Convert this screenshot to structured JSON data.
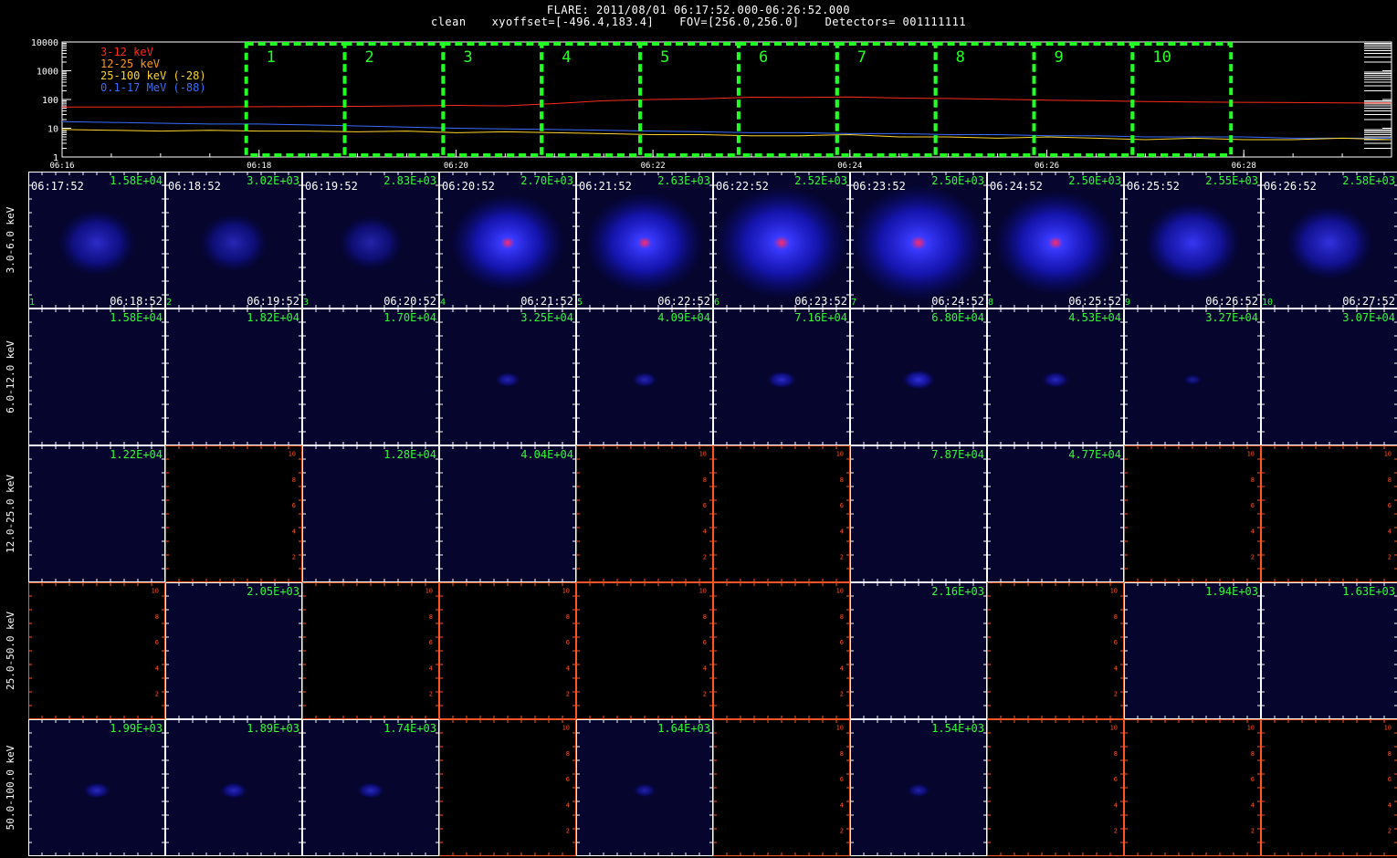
{
  "header": {
    "line1": "FLARE: 2011/08/01 06:17:52.000-06:26:52.000",
    "method": "clean",
    "xyoffset": "xyoffset=[-496.4,183.4]",
    "fov": "FOV=[256.0,256.0]",
    "detectors": "Detectors= 001111111"
  },
  "chart_data": [
    {
      "type": "line",
      "name": "lightcurve",
      "yscale": "log",
      "ylim": [
        1,
        10000
      ],
      "ytick_labels": [
        "1",
        "10",
        "100",
        "1000",
        "10000"
      ],
      "xtick_labels": [
        "06:16",
        "06:18",
        "06:20",
        "06:22",
        "06:24",
        "06:26",
        "06:28"
      ],
      "xlim_min": [
        16,
        29.5
      ],
      "legend": [
        {
          "label": "3-12 keV",
          "color": "#ff2a1a"
        },
        {
          "label": "12-25 keV",
          "color": "#ff9a1a"
        },
        {
          "label": "25-100 keV (-28)",
          "color": "#ffd52a"
        },
        {
          "label": "0.1-17 MeV (-88)",
          "color": "#3a6cff"
        }
      ],
      "series": [
        {
          "name": "3-12 keV",
          "color": "#ff2a1a",
          "x": [
            16,
            17,
            18,
            19,
            20,
            20.5,
            21,
            21.5,
            22,
            22.5,
            23,
            23.5,
            24,
            24.5,
            25,
            25.5,
            26,
            26.5,
            27,
            27.5,
            28,
            28.5,
            29,
            29.5
          ],
          "y": [
            55,
            55,
            56,
            58,
            62,
            60,
            72,
            90,
            100,
            105,
            120,
            118,
            122,
            112,
            108,
            102,
            95,
            90,
            85,
            82,
            80,
            78,
            76,
            75
          ]
        },
        {
          "name": "0.1-17 MeV (-88)",
          "color": "#3a6cff",
          "x": [
            16,
            16.5,
            17,
            17.5,
            18,
            18.5,
            19,
            19.5,
            20,
            20.5,
            21,
            21.5,
            22,
            22.5,
            23,
            23.5,
            24,
            24.5,
            25,
            25.5,
            26,
            26.5,
            27,
            27.5,
            28,
            28.5,
            29,
            29.5
          ],
          "y": [
            17,
            16,
            15,
            14,
            14,
            13,
            12,
            11,
            10,
            9.5,
            9,
            8.5,
            8,
            7.5,
            7,
            7,
            6.5,
            6.5,
            6,
            6,
            5.5,
            5.5,
            5,
            5,
            5,
            4.5,
            4.5,
            4.5
          ]
        },
        {
          "name": "25-100 keV (-28)",
          "color": "#ffd52a",
          "x": [
            16,
            16.5,
            17,
            17.5,
            18,
            18.5,
            19,
            19.5,
            20,
            20.5,
            21,
            21.5,
            22,
            22.5,
            23,
            23.5,
            24,
            24.5,
            25,
            25.5,
            26,
            26.5,
            27,
            27.5,
            28,
            28.5,
            29,
            29.5
          ],
          "y": [
            9,
            8.5,
            8,
            8.5,
            8,
            8,
            7.5,
            8,
            7,
            7.5,
            7,
            6.5,
            6,
            6,
            5.5,
            5.5,
            6,
            5,
            5,
            4.5,
            5,
            4.5,
            4,
            4.5,
            4,
            4,
            4.5,
            4
          ]
        }
      ],
      "intervals": [
        {
          "label": "1",
          "start": 17.87,
          "end": 18.87
        },
        {
          "label": "2",
          "start": 18.87,
          "end": 19.87
        },
        {
          "label": "3",
          "start": 19.87,
          "end": 20.87
        },
        {
          "label": "4",
          "start": 20.87,
          "end": 21.87
        },
        {
          "label": "5",
          "start": 21.87,
          "end": 22.87
        },
        {
          "label": "6",
          "start": 22.87,
          "end": 23.87
        },
        {
          "label": "7",
          "start": 23.87,
          "end": 24.87
        },
        {
          "label": "8",
          "start": 24.87,
          "end": 25.87
        },
        {
          "label": "9",
          "start": 25.87,
          "end": 26.87
        },
        {
          "label": "10",
          "start": 26.87,
          "end": 27.87
        }
      ]
    },
    {
      "type": "heatmap",
      "name": "image-grid",
      "row_labels": [
        "3.0-6.0 keV",
        "6.0-12.0 keV",
        "12.0-25.0 keV",
        "25.0-50.0 keV",
        "50.0-100.0 keV"
      ],
      "start_times": [
        "06:17:52",
        "06:18:52",
        "06:19:52",
        "06:20:52",
        "06:21:52",
        "06:22:52",
        "06:23:52",
        "06:24:52",
        "06:25:52",
        "06:26:52"
      ],
      "end_times": [
        "06:18:52",
        "06:19:52",
        "06:20:52",
        "06:21:52",
        "06:22:52",
        "06:23:52",
        "06:24:52",
        "06:25:52",
        "06:26:52",
        "06:27:52"
      ],
      "index_labels": [
        "1",
        "2",
        "3",
        "4",
        "5",
        "6",
        "7",
        "8",
        "9",
        "10"
      ],
      "axis_ticks": [
        "2",
        "4",
        "6",
        "8",
        "10"
      ],
      "peaks": [
        [
          "1.58E+04",
          "3.02E+03",
          "2.83E+03",
          "2.70E+03",
          "2.63E+03",
          "2.52E+03",
          "2.50E+03",
          "2.50E+03",
          "2.55E+03",
          "2.58E+03"
        ],
        [
          "1.58E+04",
          "1.82E+04",
          "1.70E+04",
          "3.25E+04",
          "4.09E+04",
          "7.16E+04",
          "6.80E+04",
          "4.53E+04",
          "3.27E+04",
          "3.07E+04"
        ],
        [
          "1.22E+04",
          "",
          "1.28E+04",
          "4.04E+04",
          "",
          "",
          "7.87E+04",
          "4.77E+04",
          "",
          ""
        ],
        [
          "",
          "2.05E+03",
          "",
          "",
          "",
          "",
          "2.16E+03",
          "",
          "1.94E+03",
          "1.63E+03"
        ],
        [
          "1.99E+03",
          "1.89E+03",
          "1.74E+03",
          "",
          "1.64E+03",
          "",
          "1.54E+03",
          "",
          "",
          ""
        ]
      ],
      "blob_intensity": [
        [
          0.35,
          0.25,
          0.2,
          0.75,
          0.8,
          0.95,
          1.0,
          0.85,
          0.55,
          0.45
        ],
        [
          0.0,
          0.0,
          0.0,
          0.25,
          0.25,
          0.35,
          0.45,
          0.3,
          0.08,
          0.0
        ],
        [
          0,
          0,
          0,
          0,
          0,
          0,
          0,
          0,
          0,
          0
        ],
        [
          0,
          0,
          0,
          0,
          0,
          0,
          0,
          0,
          0,
          0
        ],
        [
          0.3,
          0.3,
          0.3,
          0,
          0.2,
          0,
          0.2,
          0,
          0,
          0
        ]
      ],
      "colors": {
        "image_bg": "#05052e",
        "empty_bg": "#000000",
        "peak_text": "#33ff33",
        "frame": "#ffffff",
        "empty_frame": "#ff5522",
        "interval_box": "#22ff22"
      }
    }
  ]
}
